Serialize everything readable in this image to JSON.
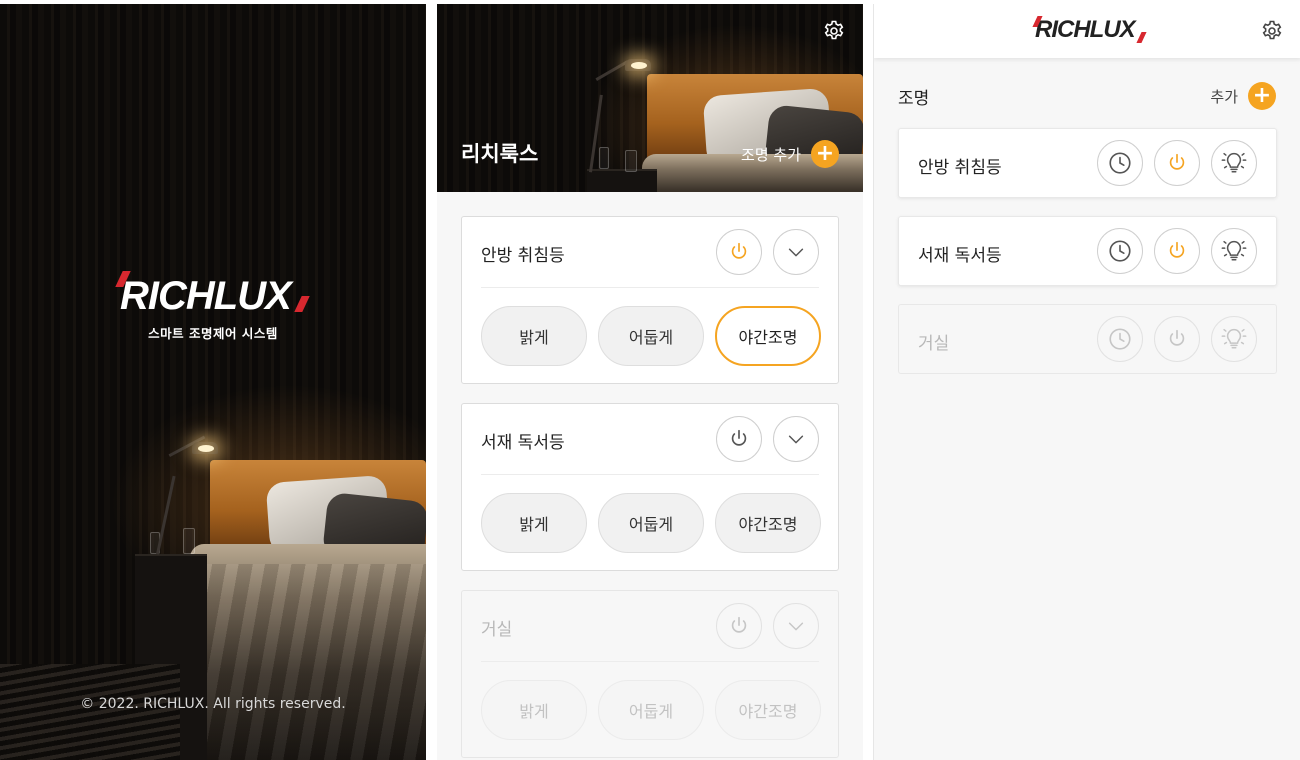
{
  "colors": {
    "accent": "#f5a421",
    "brand_red": "#d7282f",
    "disabled": "#c6c6c6"
  },
  "splash": {
    "logo_text": "RICHLUX",
    "tagline": "스마트 조명제어 시스템",
    "copyright": "© 2022. RICHLUX. All rights reserved."
  },
  "screen2": {
    "title": "리치룩스",
    "add_label": "조명 추가",
    "settings_icon": "gear-icon",
    "lights": [
      {
        "name": "안방 취침등",
        "power_on": true,
        "disabled": false,
        "modes": [
          "밝게",
          "어둡게",
          "야간조명"
        ],
        "active_mode": "야간조명"
      },
      {
        "name": "서재 독서등",
        "power_on": false,
        "disabled": false,
        "modes": [
          "밝게",
          "어둡게",
          "야간조명"
        ],
        "active_mode": ""
      },
      {
        "name": "거실",
        "power_on": false,
        "disabled": true,
        "modes": [
          "밝게",
          "어둡게",
          "야간조명"
        ],
        "active_mode": ""
      }
    ]
  },
  "screen3": {
    "logo_text": "RICHLUX",
    "section_title": "조명",
    "add_label": "추가",
    "settings_icon": "gear-icon",
    "lights": [
      {
        "name": "안방 취침등",
        "power_on": true,
        "disabled": false,
        "icons": [
          "clock-icon",
          "power-icon",
          "bulb-icon"
        ]
      },
      {
        "name": "서재 독서등",
        "power_on": true,
        "disabled": false,
        "icons": [
          "clock-icon",
          "power-icon",
          "bulb-icon"
        ]
      },
      {
        "name": "거실",
        "power_on": false,
        "disabled": true,
        "icons": [
          "clock-icon",
          "power-icon",
          "bulb-icon"
        ]
      }
    ]
  }
}
